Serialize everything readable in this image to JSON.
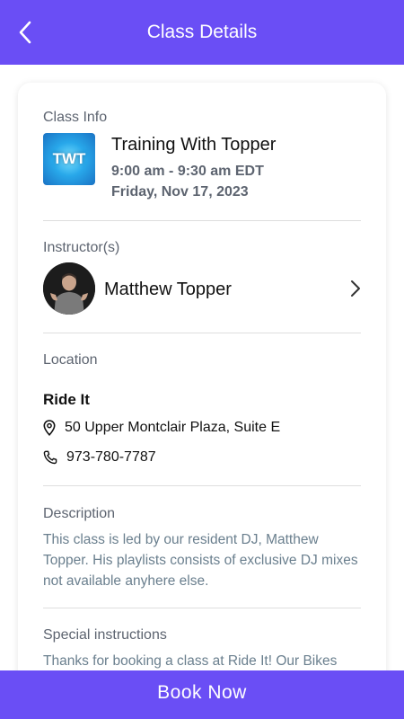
{
  "header": {
    "title": "Class Details"
  },
  "class_info": {
    "label": "Class Info",
    "logo_text": "TWT",
    "name": "Training With Topper",
    "time": "9:00 am - 9:30 am EDT",
    "date": "Friday, Nov 17, 2023"
  },
  "instructors": {
    "label": "Instructor(s)",
    "name": "Matthew Topper"
  },
  "location": {
    "label": "Location",
    "name": "Ride It",
    "address": "50 Upper Montclair Plaza, Suite E",
    "phone": "973-780-7787"
  },
  "description": {
    "label": "Description",
    "text": "This class is led by our resident DJ, Matthew Topper. His playlists consists of exclusive DJ mixes not available anyhere else."
  },
  "special_instructions": {
    "label": "Special instructions",
    "text": "Thanks for booking a class at Ride It! Our Bikes"
  },
  "footer": {
    "book_label": "Book Now"
  },
  "colors": {
    "brand": "#6a4ef5",
    "muted_text": "#5d6470",
    "desc_text": "#6a7f8e"
  }
}
